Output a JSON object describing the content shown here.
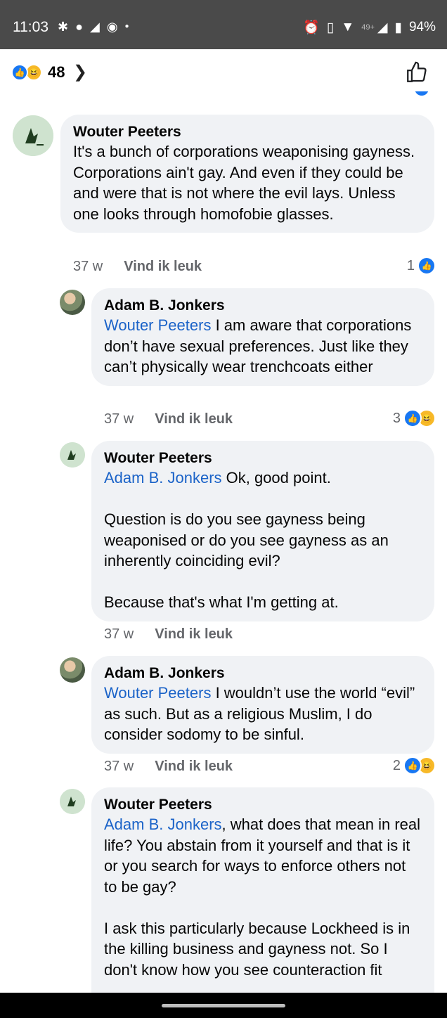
{
  "status_bar": {
    "time": "11:03",
    "network_label": "49+",
    "battery": "94%",
    "left_icons": [
      "gear-icon",
      "chat-bubble-icon",
      "telegram-icon",
      "messenger-icon",
      "dot-icon"
    ],
    "right_icons": [
      "alarm-icon",
      "vibrate-icon",
      "wifi-icon",
      "signal-icon",
      "battery-icon"
    ]
  },
  "header": {
    "reaction_count": "48",
    "reactions": [
      "like",
      "haha"
    ],
    "like_color": "#1877f2",
    "haha_color": "#f7b928"
  },
  "comments": [
    {
      "author": "Wouter Peeters",
      "mention": "",
      "text": "It's a bunch of corporations weaponising gayness.  Corporations ain't gay.  And even if they could be and were that is not where the evil lays.  Unless one looks through homofobie glasses.",
      "age": "37 w",
      "like_label": "Vind ik leuk",
      "reaction_count": "1",
      "reactions": [
        "like"
      ]
    },
    {
      "author": "Adam B. Jonkers",
      "mention": "Wouter Peeters",
      "text": " I am aware that corporations don’t have sexual preferences. Just like they can’t physically wear trenchcoats either",
      "age": "37 w",
      "like_label": "Vind ik leuk",
      "reaction_count": "3",
      "reactions": [
        "like",
        "haha"
      ]
    },
    {
      "author": "Wouter Peeters",
      "mention": "Adam B. Jonkers",
      "text": " Ok, good point.\n\nQuestion is do you see gayness being weaponised or do you see gayness as an inherently coinciding evil?\n\nBecause that's what I'm getting at.",
      "age": "37 w",
      "like_label": "Vind ik leuk",
      "reaction_count": "",
      "reactions": []
    },
    {
      "author": "Adam B. Jonkers",
      "mention": "Wouter Peeters",
      "text": " I wouldn’t use the world “evil” as such. But as a religious Muslim, I do consider sodomy to be sinful.",
      "age": "37 w",
      "like_label": "Vind ik leuk",
      "reaction_count": "2",
      "reactions": [
        "like",
        "haha"
      ]
    },
    {
      "author": "Wouter Peeters",
      "mention": "Adam B. Jonkers",
      "text": ", what does that mean in real life?  You abstain from it yourself and that is it or you search for ways to enforce others not to be gay?\n\nI ask this particularly because Lockheed is in the killing business and gayness not.  So I don't know how you see counteraction fit",
      "age": "",
      "like_label": "",
      "reaction_count": "",
      "reactions": []
    }
  ]
}
